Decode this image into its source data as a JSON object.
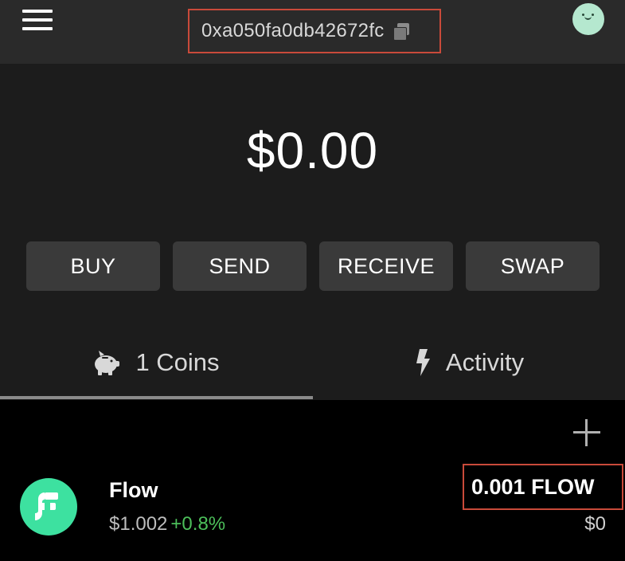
{
  "header": {
    "address": "0xa050fa0db42672fc",
    "menu_icon": "hamburger-menu-icon",
    "copy_icon": "copy-icon",
    "avatar_color": "#b5e8cf"
  },
  "wallet": {
    "balance": "$0.00"
  },
  "actions": {
    "buy": "BUY",
    "send": "SEND",
    "receive": "RECEIVE",
    "swap": "SWAP"
  },
  "tabs": {
    "coins": {
      "label": "1 Coins",
      "icon": "piggy-bank-icon",
      "active": true
    },
    "activity": {
      "label": "Activity",
      "icon": "lightning-bolt-icon",
      "active": false
    }
  },
  "coins": [
    {
      "name": "Flow",
      "price": "$1.002",
      "change": "+0.8%",
      "amount": "0.001 FLOW",
      "fiat_value": "$0",
      "logo_color": "#3de1a0",
      "change_color": "#4cbf5a"
    }
  ],
  "colors": {
    "highlight_border": "#c94a3a",
    "background": "#1c1c1c",
    "topbar": "#2a2a2a",
    "button": "#3a3a3a"
  }
}
